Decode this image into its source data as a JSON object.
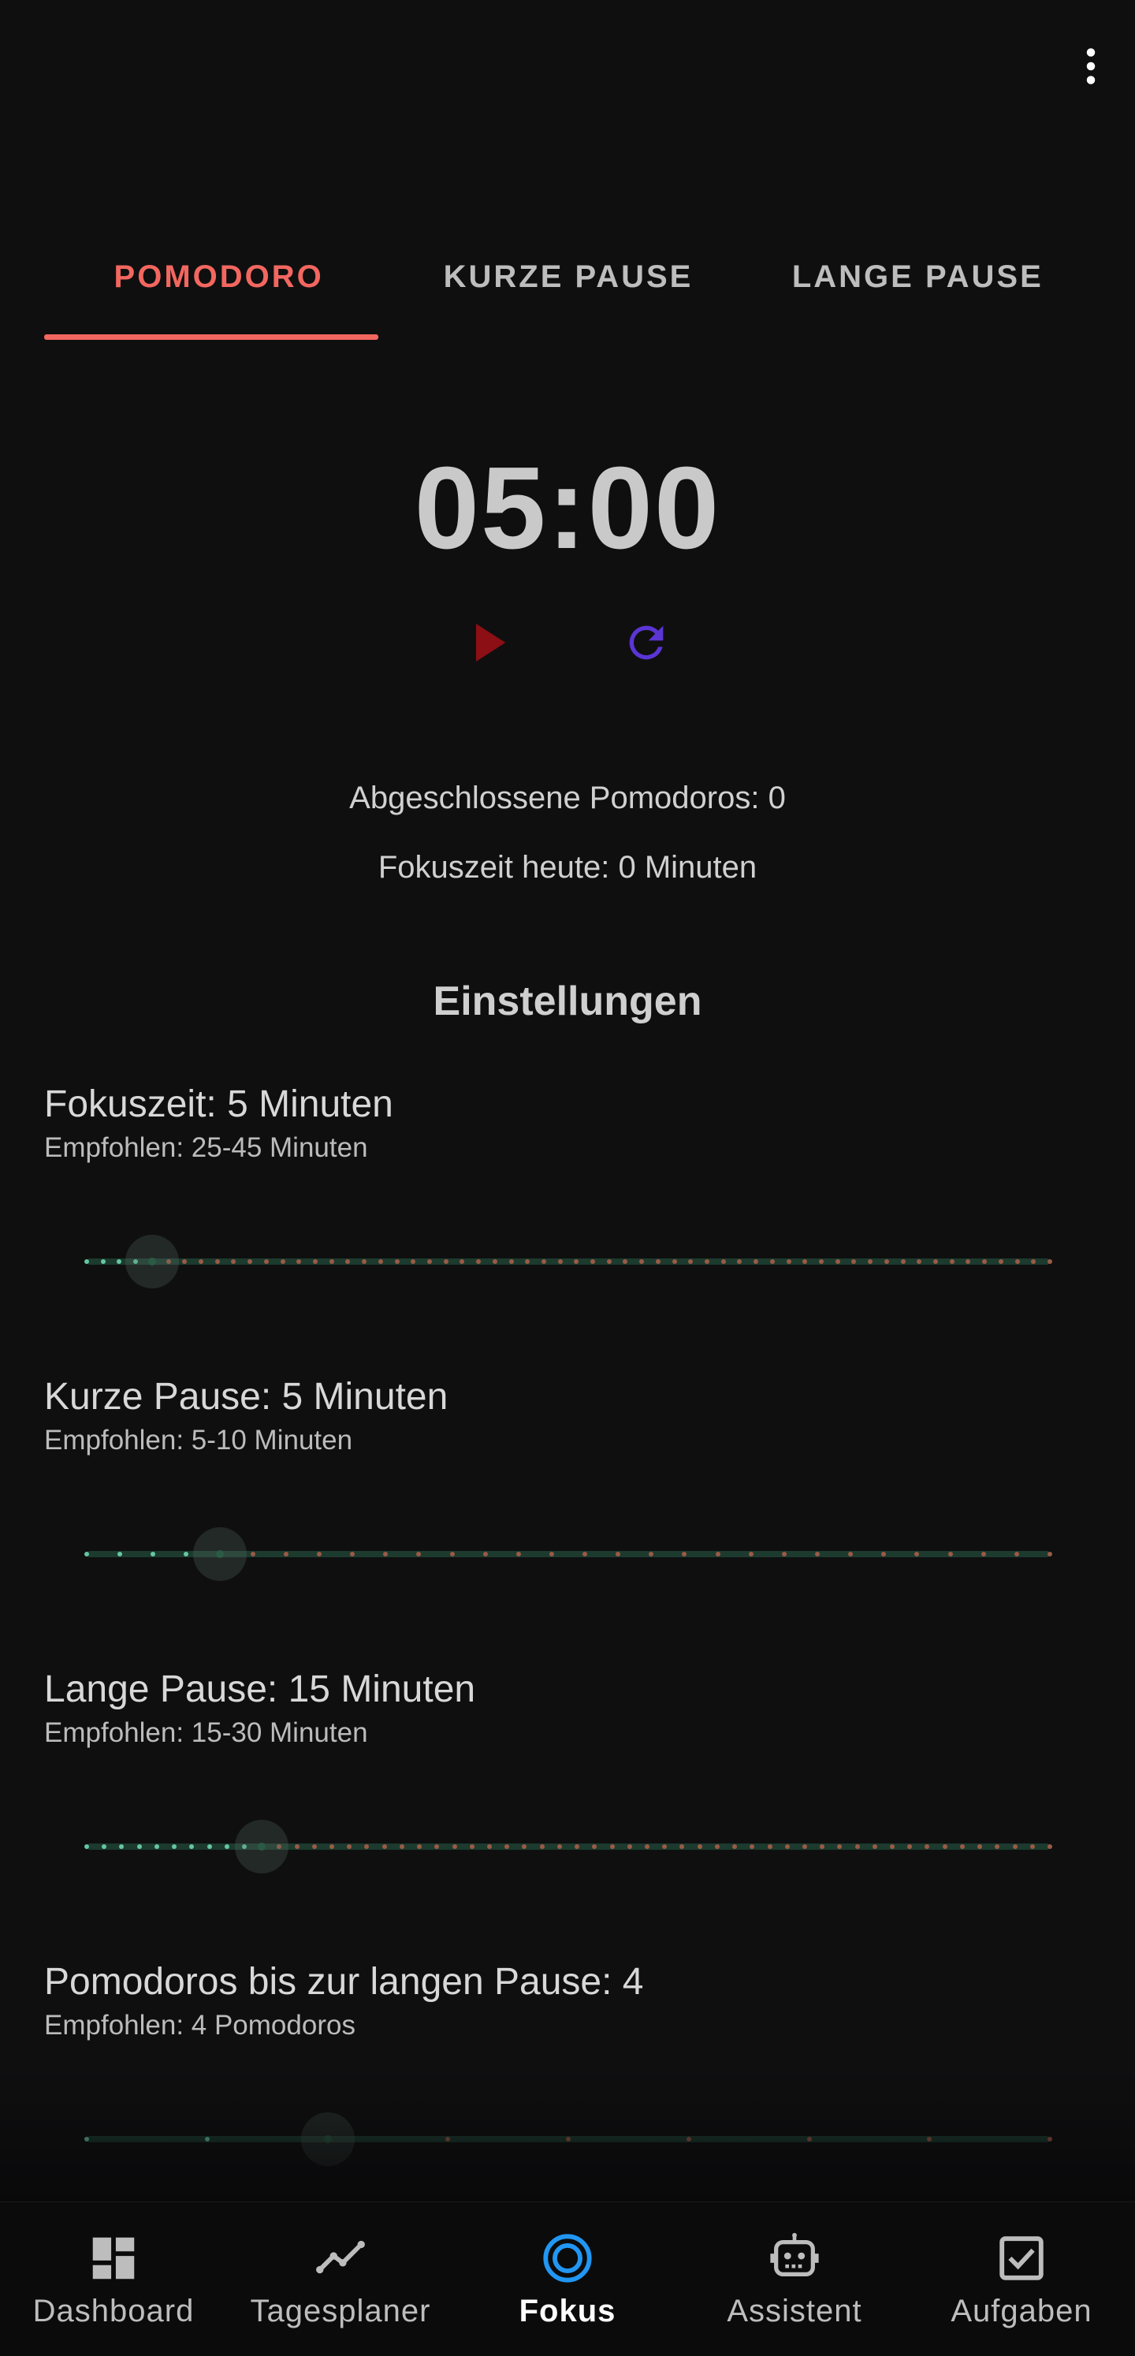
{
  "header": {
    "more_icon": "more-vert-icon"
  },
  "tabs": [
    {
      "label": "POMODORO",
      "active": true
    },
    {
      "label": "KURZE PAUSE",
      "active": false
    },
    {
      "label": "LANGE PAUSE",
      "active": false
    }
  ],
  "timer": {
    "display": "05:00",
    "play_icon": "play-icon",
    "reset_icon": "refresh-icon"
  },
  "stats": {
    "completed": "Abgeschlossene Pomodoros: 0",
    "focus_today": "Fokuszeit heute: 0 Minuten"
  },
  "settings": {
    "title": "Einstellungen",
    "items": [
      {
        "label": "Fokuszeit: 5 Minuten",
        "hint": "Empfohlen: 25-45 Minuten",
        "value": 5,
        "min": 1,
        "max": 60
      },
      {
        "label": "Kurze Pause: 5 Minuten",
        "hint": "Empfohlen: 5-10 Minuten",
        "value": 5,
        "min": 1,
        "max": 30
      },
      {
        "label": "Lange Pause: 15 Minuten",
        "hint": "Empfohlen: 15-30 Minuten",
        "value": 15,
        "min": 5,
        "max": 60
      },
      {
        "label": "Pomodoros bis zur langen Pause: 4",
        "hint": "Empfohlen: 4 Pomodoros",
        "value": 4,
        "min": 2,
        "max": 10
      }
    ]
  },
  "nav": [
    {
      "label": "Dashboard",
      "icon": "dashboard-icon",
      "active": false
    },
    {
      "label": "Tagesplaner",
      "icon": "trend-line-icon",
      "active": false
    },
    {
      "label": "Fokus",
      "icon": "focus-target-icon",
      "active": true
    },
    {
      "label": "Assistent",
      "icon": "robot-icon",
      "active": false
    },
    {
      "label": "Aufgaben",
      "icon": "checkbox-icon",
      "active": false
    }
  ],
  "colors": {
    "accent": "#f2675f",
    "play": "#8b0f14",
    "reset": "#5b35d4",
    "nav_active": "#2196f3",
    "dot_active": "#66c6a4",
    "dot_inactive": "#9a5a45"
  }
}
